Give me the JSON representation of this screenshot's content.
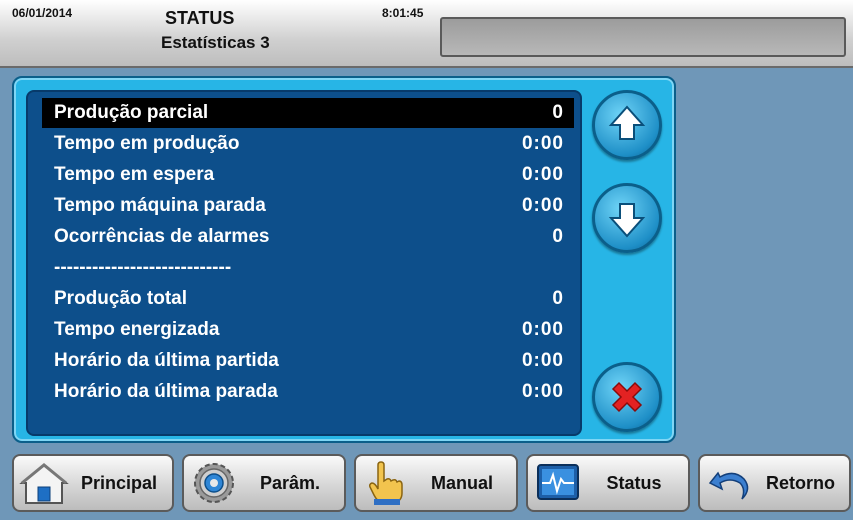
{
  "header": {
    "date": "06/01/2014",
    "time": "8:01:45",
    "title": "STATUS",
    "subtitle": "Estatísticas 3",
    "message": ""
  },
  "stats": [
    {
      "label": "Produção parcial",
      "value": "0",
      "selected": true
    },
    {
      "label": "Tempo em produção",
      "value": "0:00"
    },
    {
      "label": "Tempo em espera",
      "value": "0:00"
    },
    {
      "label": "Tempo máquina parada",
      "value": "0:00"
    },
    {
      "label": "Ocorrências de alarmes",
      "value": "0"
    },
    {
      "label": "----------------------------",
      "value": ""
    },
    {
      "label": "Produção total",
      "value": "0"
    },
    {
      "label": "Tempo energizada",
      "value": "0:00"
    },
    {
      "label": "Horário da última partida",
      "value": "0:00"
    },
    {
      "label": "Horário da última parada",
      "value": "0:00"
    }
  ],
  "side_buttons": {
    "up": "arrow-up-icon",
    "down": "arrow-down-icon",
    "close": "close-x-icon"
  },
  "nav": {
    "principal": "Principal",
    "param": "Parâm.",
    "manual": "Manual",
    "status": "Status",
    "retorno": "Retorno"
  },
  "colors": {
    "background": "#6f97b8",
    "panel": "#27b5e6",
    "list": "#0d4f8b",
    "selected_row": "#000000",
    "close_icon": "#e32222"
  }
}
